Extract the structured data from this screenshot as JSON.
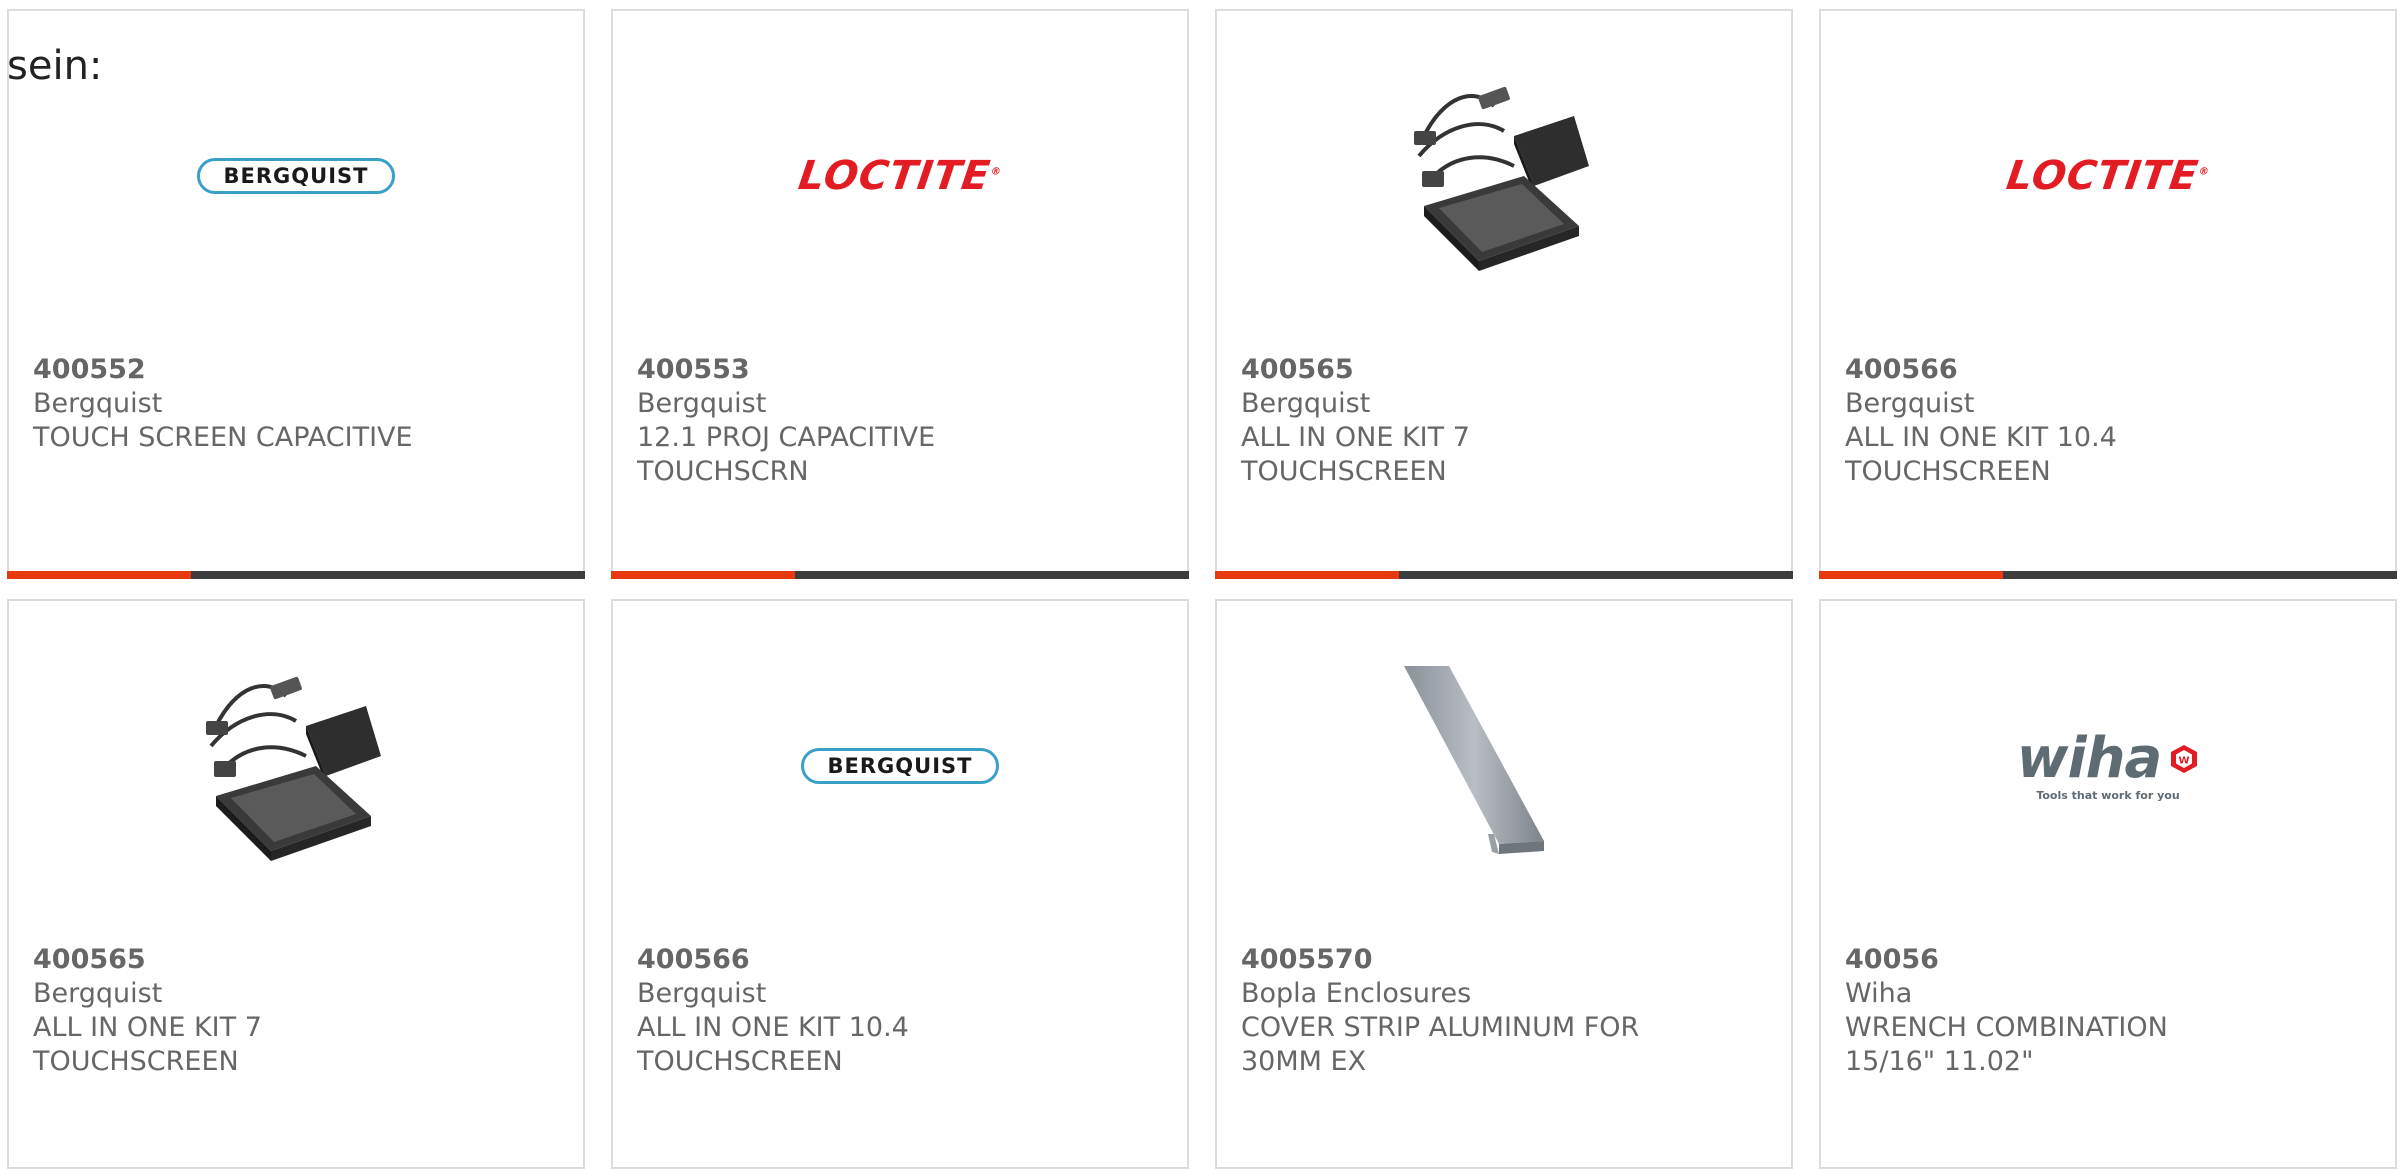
{
  "intro_text": "sein:",
  "colors": {
    "accent": "#e8380d",
    "bar_dark": "#3d3d3d",
    "card_border": "#dcdcdc",
    "text": "#666666",
    "bergquist_blue": "#3aa0c8",
    "loctite_red": "#e31b23",
    "wiha_gray": "#5f6b73"
  },
  "products": [
    {
      "part_number": "400552",
      "manufacturer": "Bergquist",
      "description": "TOUCH SCREEN CAPACITIVE",
      "image": "bergquist-logo",
      "logo_text": "BERGQUIST"
    },
    {
      "part_number": "400553",
      "manufacturer": "Bergquist",
      "description": "12.1 PROJ CAPACITIVE TOUCHSCRN",
      "image": "loctite-logo",
      "logo_text": "LOCTITE"
    },
    {
      "part_number": "400565",
      "manufacturer": "Bergquist",
      "description": "ALL IN ONE KIT 7 TOUCHSCREEN",
      "image": "touchscreen-kit-photo"
    },
    {
      "part_number": "400566",
      "manufacturer": "Bergquist",
      "description": "ALL IN ONE KIT 10.4 TOUCHSCREEN",
      "image": "loctite-logo",
      "logo_text": "LOCTITE"
    },
    {
      "part_number": "400565",
      "manufacturer": "Bergquist",
      "description": "ALL IN ONE KIT 7 TOUCHSCREEN",
      "image": "touchscreen-kit-photo"
    },
    {
      "part_number": "400566",
      "manufacturer": "Bergquist",
      "description": "ALL IN ONE KIT 10.4 TOUCHSCREEN",
      "image": "bergquist-logo",
      "logo_text": "BERGQUIST"
    },
    {
      "part_number": "4005570",
      "manufacturer": "Bopla Enclosures",
      "description": "COVER STRIP ALUMINUM FOR 30MM EX",
      "image": "aluminum-strip-photo"
    },
    {
      "part_number": "40056",
      "manufacturer": "Wiha",
      "description": "WRENCH COMBINATION 15/16\" 11.02\"",
      "image": "wiha-logo",
      "logo_text": "wiha",
      "logo_tagline": "Tools that work for you"
    }
  ]
}
